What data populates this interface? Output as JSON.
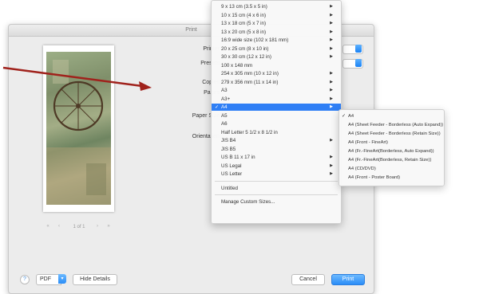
{
  "dialog": {
    "title": "Print",
    "labels": {
      "printer": "Printer",
      "presets": "Presets",
      "copies": "Copies",
      "pages": "Pages",
      "paper_size": "Paper Size",
      "orientation": "Orientation"
    },
    "pager": {
      "first": "«",
      "prev": "‹",
      "count": "1 of 1",
      "next": "›",
      "last": "»"
    },
    "bottom": {
      "help": "?",
      "pdf_label": "PDF",
      "pdf_arrow": "▾",
      "hide_details": "Hide Details",
      "cancel": "Cancel",
      "print": "Print"
    }
  },
  "paper_menu": {
    "check": "✓",
    "submenu_arrow": "▶",
    "items": [
      {
        "label": "9 x 13 cm (3.5 x 5 in)",
        "sub": true
      },
      {
        "label": "10 x 15 cm (4 x 6 in)",
        "sub": true
      },
      {
        "label": "13 x 18 cm (5 x 7 in)",
        "sub": true
      },
      {
        "label": "13 x 20 cm (5 x 8 in)",
        "sub": true
      },
      {
        "label": "16:9 wide size (102 x 181 mm)",
        "sub": true
      },
      {
        "label": "20 x 25 cm (8 x 10 in)",
        "sub": true
      },
      {
        "label": "30 x 30 cm (12 x 12 in)",
        "sub": true
      },
      {
        "label": "100 x 148 mm",
        "sub": false
      },
      {
        "label": "254 x 305 mm (10 x 12 in)",
        "sub": true
      },
      {
        "label": "279 x 356 mm (11 x 14 in)",
        "sub": true
      },
      {
        "label": "A3",
        "sub": true
      },
      {
        "label": "A3+",
        "sub": true
      },
      {
        "label": "A4",
        "sub": true,
        "selected": true
      },
      {
        "label": "A5",
        "sub": false
      },
      {
        "label": "A6",
        "sub": false
      },
      {
        "label": "Half Letter 5 1/2 x 8 1/2 in",
        "sub": false
      },
      {
        "label": "JIS B4",
        "sub": true
      },
      {
        "label": "JIS B5",
        "sub": false
      },
      {
        "label": "US B 11 x 17 in",
        "sub": true
      },
      {
        "label": "US Legal",
        "sub": true
      },
      {
        "label": "US Letter",
        "sub": true
      }
    ],
    "untitled": "Untitled",
    "manage": "Manage Custom Sizes..."
  },
  "a4_submenu": {
    "items": [
      {
        "label": "A4",
        "checked": true
      },
      {
        "label": "A4 (Sheet Feeder - Borderless (Auto Expand))"
      },
      {
        "label": "A4 (Sheet Feeder - Borderless (Retain Size))"
      },
      {
        "label": "A4 (Front - FineArt)"
      },
      {
        "label": "A4 (Fr.-FineArt(Borderless, Auto Expand))"
      },
      {
        "label": "A4 (Fr.-FineArt(Borderless, Retain Size))"
      },
      {
        "label": "A4 (CD/DVD)"
      },
      {
        "label": "A4 (Front - Poster Board)"
      }
    ]
  },
  "colors": {
    "accent": "#2f7ff5",
    "annotation_arrow": "#a0221c"
  }
}
